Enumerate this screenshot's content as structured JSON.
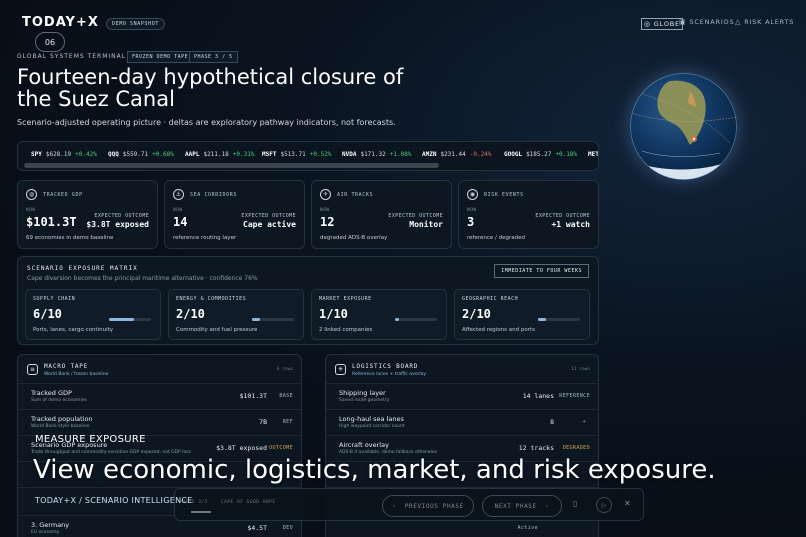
{
  "header": {
    "logo": "TODAY+X",
    "demo_badge": "DEMO SNAPSHOT",
    "nav": [
      {
        "label": "GLOBE",
        "icon": "globe-icon",
        "active": true
      },
      {
        "label": "SCENARIOS",
        "icon": "grid-icon",
        "active": false
      },
      {
        "label": "RISK ALERTS",
        "icon": "warning-icon",
        "active": false
      }
    ]
  },
  "phase_number": "06",
  "terminal_label": "GLOBAL SYSTEMS TERMINAL",
  "tags": [
    "FROZEN DEMO TAPE",
    "PHASE 3 / 5"
  ],
  "title": "Fourteen-day hypothetical closure of the Suez Canal",
  "description": "Scenario-adjusted operating picture · deltas are exploratory pathway indicators, not forecasts.",
  "ticker": [
    {
      "sym": "SPY",
      "price": "$628.19",
      "chg": "+0.42%",
      "dir": "up"
    },
    {
      "sym": "QQQ",
      "price": "$559.71",
      "chg": "+0.68%",
      "dir": "up"
    },
    {
      "sym": "AAPL",
      "price": "$211.18",
      "chg": "+0.31%",
      "dir": "up"
    },
    {
      "sym": "MSFT",
      "price": "$513.71",
      "chg": "+0.52%",
      "dir": "up"
    },
    {
      "sym": "NVDA",
      "price": "$171.32",
      "chg": "+1.08%",
      "dir": "up"
    },
    {
      "sym": "AMZN",
      "price": "$231.44",
      "chg": "-0.24%",
      "dir": "dn"
    },
    {
      "sym": "GOOGL",
      "price": "$185.27",
      "chg": "+0.18%",
      "dir": "up"
    },
    {
      "sym": "MET",
      "price": "",
      "chg": "",
      "dir": "up"
    }
  ],
  "cards": [
    {
      "icon": "globe-icon",
      "title": "TRACKED GDP",
      "now": "NOW",
      "value": "$101.3T",
      "outcome_label": "EXPECTED OUTCOME",
      "outcome": "$3.8T exposed",
      "note": "69 economies in demo baseline"
    },
    {
      "icon": "anchor-icon",
      "title": "SEA CORRIDORS",
      "now": "NOW",
      "value": "14",
      "outcome_label": "EXPECTED OUTCOME",
      "outcome": "Cape active",
      "note": "reference routing layer"
    },
    {
      "icon": "plane-icon",
      "title": "AIR TRACKS",
      "now": "NOW",
      "value": "12",
      "outcome_label": "EXPECTED OUTCOME",
      "outcome": "Monitor",
      "note": "degraded ADS-B overlay"
    },
    {
      "icon": "radar-icon",
      "title": "RISK EVENTS",
      "now": "NOW",
      "value": "3",
      "outcome_label": "EXPECTED OUTCOME",
      "outcome": "+1 watch",
      "note": "reference / degraded"
    }
  ],
  "matrix": {
    "title": "SCENARIO EXPOSURE MATRIX",
    "subtitle": "Cape diversion becomes the principal maritime alternative · confidence 76%",
    "button": "IMMEDIATE TO FOUR WEEKS",
    "cells": [
      {
        "head": "SUPPLY CHAIN",
        "score": "6/10",
        "level": 0.6,
        "note": "Ports, lanes, cargo continuity"
      },
      {
        "head": "ENERGY & COMMODITIES",
        "score": "2/10",
        "level": 0.2,
        "note": "Commodity and fuel pressure"
      },
      {
        "head": "MARKET EXPOSURE",
        "score": "1/10",
        "level": 0.1,
        "note": "2 linked companies"
      },
      {
        "head": "GEOGRAPHIC REACH",
        "score": "2/10",
        "level": 0.2,
        "note": "Affected regions and ports"
      }
    ]
  },
  "macro": {
    "title": "MACRO TAPE",
    "subtitle": "World Bank / frozen baseline",
    "count": "6 rows",
    "rows": [
      {
        "label": "Tracked GDP",
        "sub": "Sum of demo economies",
        "value": "$101.3T",
        "tag": "BASE"
      },
      {
        "label": "Tracked population",
        "sub": "World Bank-style baseline",
        "value": "7B",
        "tag": "REF"
      },
      {
        "label": "Scenario GDP exposure",
        "sub": "Trade throughput and commodity-sensitive GDP exposed, not GDP loss",
        "value": "$3.8T exposed",
        "tag": "OUTCOME"
      },
      {
        "label": "",
        "sub": "",
        "value": "",
        "tag": ""
      },
      {
        "label": "",
        "sub": "",
        "value": "",
        "tag": ""
      },
      {
        "label": "3. Germany",
        "sub": "EU economy",
        "value": "$4.5T",
        "tag": "DEU"
      }
    ]
  },
  "logistics": {
    "title": "LOGISTICS BOARD",
    "subtitle": "Reference lanes + traffic overlay",
    "count": "11 rows",
    "rows": [
      {
        "label": "Shipping layer",
        "sub": "Saved route geometry",
        "value": "14 lanes",
        "tag": "REFERENCE"
      },
      {
        "label": "Long-haul sea lanes",
        "sub": "High waypoint corridor count",
        "value": "8",
        "tag": "+"
      },
      {
        "label": "Aircraft overlay",
        "sub": "ADS-B if available, demo fallback otherwise",
        "value": "12 tracks",
        "tag": "DEGRADED"
      },
      {
        "label": "",
        "sub": "",
        "value": "",
        "tag": ""
      },
      {
        "label": "",
        "sub": "",
        "value": "",
        "tag": ""
      },
      {
        "label": "",
        "sub": "",
        "value": "",
        "tag": "Active"
      }
    ]
  },
  "overlay": {
    "section": "MEASURE EXPOSURE",
    "caption": "View economic, logistics, market, and risk exposure.",
    "brand": "TODAY+X",
    "brand_sub": "SCENARIO INTELLIGENCE",
    "phase_label": "PHASE 3/5",
    "location": "CAPE OF GOOD HOPE",
    "prev": "PREVIOUS PHASE",
    "next": "NEXT PHASE"
  }
}
